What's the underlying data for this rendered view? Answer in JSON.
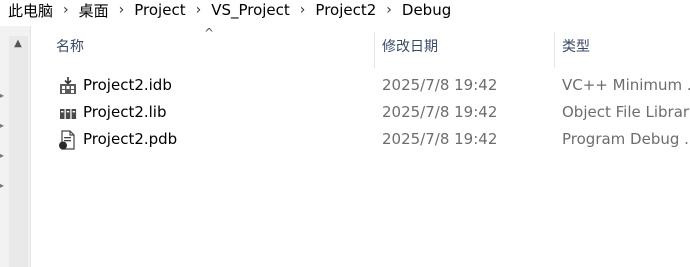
{
  "breadcrumb": {
    "items": [
      "此电脑",
      "桌面",
      "Project",
      "VS_Project",
      "Project2",
      "Debug"
    ],
    "separator": "›"
  },
  "columns": {
    "name": "名称",
    "date": "修改日期",
    "type": "类型"
  },
  "files": [
    {
      "name": "Project2.idb",
      "date": "2025/7/8 19:42",
      "type": "VC++ Minimum ...",
      "icon": "idb-file-icon"
    },
    {
      "name": "Project2.lib",
      "date": "2025/7/8 19:42",
      "type": "Object File Library",
      "icon": "lib-file-icon"
    },
    {
      "name": "Project2.pdb",
      "date": "2025/7/8 19:42",
      "type": "Program Debug ...",
      "icon": "pdb-file-icon"
    }
  ],
  "colors": {
    "header_text": "#3a4a66",
    "secondary_text": "#6d6d6d",
    "nav_background": "#f2f2f2"
  }
}
